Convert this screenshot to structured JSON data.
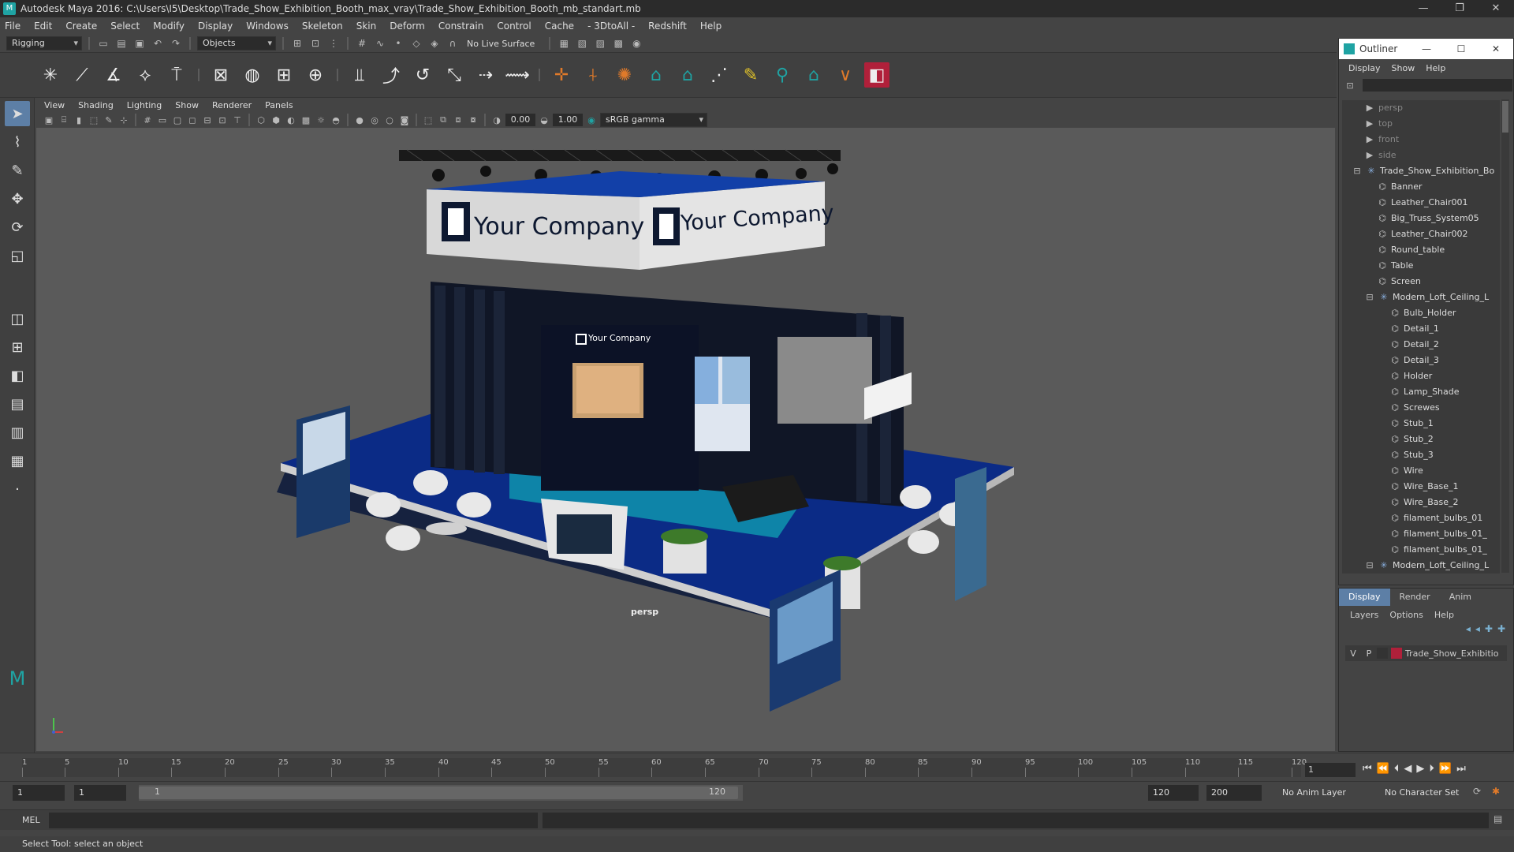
{
  "window": {
    "title": "Autodesk Maya 2016: C:\\Users\\I5\\Desktop\\Trade_Show_Exhibition_Booth_max_vray\\Trade_Show_Exhibition_Booth_mb_standart.mb",
    "app_icon": "maya-icon"
  },
  "menubar": [
    "File",
    "Edit",
    "Create",
    "Select",
    "Modify",
    "Display",
    "Windows",
    "Skeleton",
    "Skin",
    "Deform",
    "Constrain",
    "Control",
    "Cache",
    "- 3DtoAll -",
    "Redshift",
    "Help"
  ],
  "statusline": {
    "menuset": "Rigging",
    "selection_mode": "Objects",
    "live_surface": "No Live Surface"
  },
  "viewport": {
    "menu": [
      "View",
      "Shading",
      "Lighting",
      "Show",
      "Renderer",
      "Panels"
    ],
    "exposure": "0.00",
    "gamma": "1.00",
    "color_space": "sRGB gamma",
    "camera_label": "persp",
    "scene": {
      "banner_text_left": "Your Company",
      "banner_text_right": "Your Company",
      "wall_logo": "Your Company"
    }
  },
  "outliner": {
    "title": "Outliner",
    "menu": [
      "Display",
      "Show",
      "Help"
    ],
    "items": [
      {
        "label": "persp",
        "icon": "camera-icon",
        "dim": true,
        "indent": 1
      },
      {
        "label": "top",
        "icon": "camera-icon",
        "dim": true,
        "indent": 1
      },
      {
        "label": "front",
        "icon": "camera-icon",
        "dim": true,
        "indent": 1
      },
      {
        "label": "side",
        "icon": "camera-icon",
        "dim": true,
        "indent": 1
      },
      {
        "label": "Trade_Show_Exhibition_Bo",
        "icon": "group-icon",
        "dim": false,
        "indent": 0
      },
      {
        "label": "Banner",
        "icon": "mesh-icon",
        "dim": false,
        "indent": 2
      },
      {
        "label": "Leather_Chair001",
        "icon": "mesh-icon",
        "dim": false,
        "indent": 2
      },
      {
        "label": "Big_Truss_System05",
        "icon": "mesh-icon",
        "dim": false,
        "indent": 2
      },
      {
        "label": "Leather_Chair002",
        "icon": "mesh-icon",
        "dim": false,
        "indent": 2
      },
      {
        "label": "Round_table",
        "icon": "mesh-icon",
        "dim": false,
        "indent": 2
      },
      {
        "label": "Table",
        "icon": "mesh-icon",
        "dim": false,
        "indent": 2
      },
      {
        "label": "Screen",
        "icon": "mesh-icon",
        "dim": false,
        "indent": 2
      },
      {
        "label": "Modern_Loft_Ceiling_L",
        "icon": "group-icon",
        "dim": false,
        "indent": 1
      },
      {
        "label": "Bulb_Holder",
        "icon": "mesh-icon",
        "dim": false,
        "indent": 3
      },
      {
        "label": "Detail_1",
        "icon": "mesh-icon",
        "dim": false,
        "indent": 3
      },
      {
        "label": "Detail_2",
        "icon": "mesh-icon",
        "dim": false,
        "indent": 3
      },
      {
        "label": "Detail_3",
        "icon": "mesh-icon",
        "dim": false,
        "indent": 3
      },
      {
        "label": "Holder",
        "icon": "mesh-icon",
        "dim": false,
        "indent": 3
      },
      {
        "label": "Lamp_Shade",
        "icon": "mesh-icon",
        "dim": false,
        "indent": 3
      },
      {
        "label": "Screwes",
        "icon": "mesh-icon",
        "dim": false,
        "indent": 3
      },
      {
        "label": "Stub_1",
        "icon": "mesh-icon",
        "dim": false,
        "indent": 3
      },
      {
        "label": "Stub_2",
        "icon": "mesh-icon",
        "dim": false,
        "indent": 3
      },
      {
        "label": "Stub_3",
        "icon": "mesh-icon",
        "dim": false,
        "indent": 3
      },
      {
        "label": "Wire",
        "icon": "mesh-icon",
        "dim": false,
        "indent": 3
      },
      {
        "label": "Wire_Base_1",
        "icon": "mesh-icon",
        "dim": false,
        "indent": 3
      },
      {
        "label": "Wire_Base_2",
        "icon": "mesh-icon",
        "dim": false,
        "indent": 3
      },
      {
        "label": "filament_bulbs_01",
        "icon": "mesh-icon",
        "dim": false,
        "indent": 3
      },
      {
        "label": "filament_bulbs_01_",
        "icon": "mesh-icon",
        "dim": false,
        "indent": 3
      },
      {
        "label": "filament_bulbs_01_",
        "icon": "mesh-icon",
        "dim": false,
        "indent": 3
      },
      {
        "label": "Modern_Loft_Ceiling_L",
        "icon": "group-icon",
        "dim": false,
        "indent": 1
      }
    ]
  },
  "layer_editor": {
    "tabs": [
      "Display",
      "Render",
      "Anim"
    ],
    "active_tab": "Display",
    "menu": [
      "Layers",
      "Options",
      "Help"
    ],
    "layer": {
      "v": "V",
      "p": "P",
      "name": "Trade_Show_Exhibitio",
      "color": "#b0203a"
    }
  },
  "timeslider": {
    "ticks": [
      "1",
      "5",
      "10",
      "15",
      "20",
      "25",
      "30",
      "35",
      "40",
      "45",
      "50",
      "55",
      "60",
      "65",
      "70",
      "75",
      "80",
      "85",
      "90",
      "95",
      "100",
      "105",
      "110",
      "115",
      "120"
    ],
    "current_frame": "1"
  },
  "range": {
    "start": "1",
    "inner_start": "1",
    "slider_start": "1",
    "slider_end": "120",
    "end": "120",
    "outer_end": "200",
    "anim_layer": "No Anim Layer",
    "character_set": "No Character Set"
  },
  "command_line": {
    "label": "MEL"
  },
  "help_line": "Select Tool: select an object",
  "colors": {
    "accent": "#5d7fa6",
    "booth_floor": "#0a2a7a",
    "teal": "#0f9bb0",
    "dark_wall": "#101626"
  }
}
